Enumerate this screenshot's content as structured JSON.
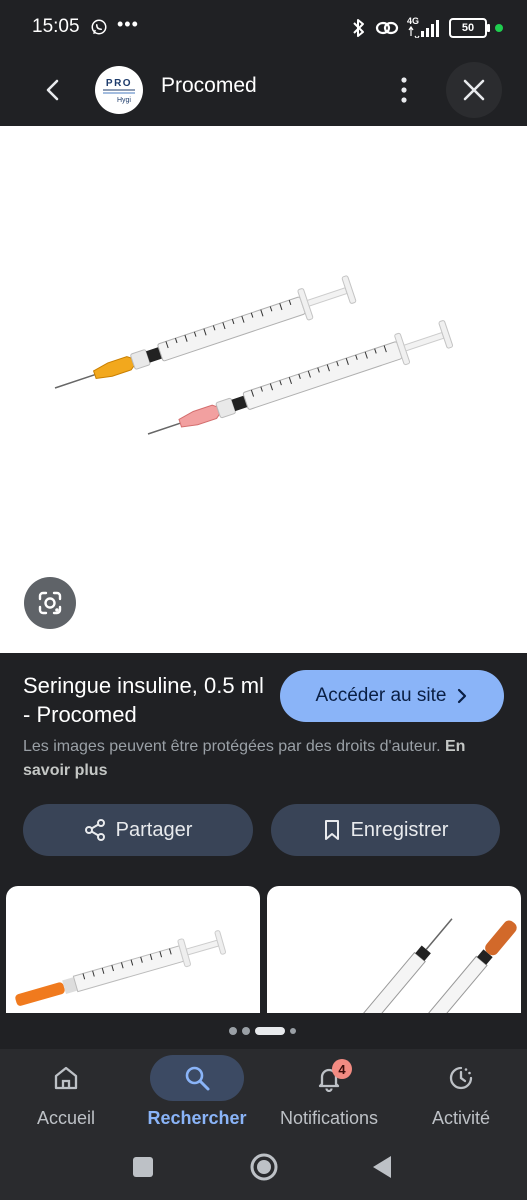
{
  "status_bar": {
    "time": "15:05",
    "network": "4G",
    "battery": "50"
  },
  "app_bar": {
    "title": "Procomed",
    "logo_text_top": "PRO",
    "logo_text_bottom": "Hygi"
  },
  "result": {
    "title": "Seringue insuline, 0.5 ml - Procomed",
    "visit_label": "Accéder au site",
    "copyright_text": "Les images peuvent être protégées par des droits d'auteur.",
    "learn_more": "En savoir plus",
    "share_label": "Partager",
    "save_label": "Enregistrer"
  },
  "pager": {
    "dot_count": 4,
    "active_index": 2
  },
  "bottom_nav": {
    "items": [
      {
        "label": "Accueil",
        "icon": "home-icon"
      },
      {
        "label": "Rechercher",
        "icon": "search-icon"
      },
      {
        "label": "Notifications",
        "icon": "bell-icon",
        "badge": "4"
      },
      {
        "label": "Activité",
        "icon": "activity-icon"
      }
    ]
  },
  "colors": {
    "accent": "#8ab4f8",
    "background": "#202124",
    "button_bg": "#394457",
    "badge": "#f28b82",
    "status_dot": "#1fce4f"
  }
}
